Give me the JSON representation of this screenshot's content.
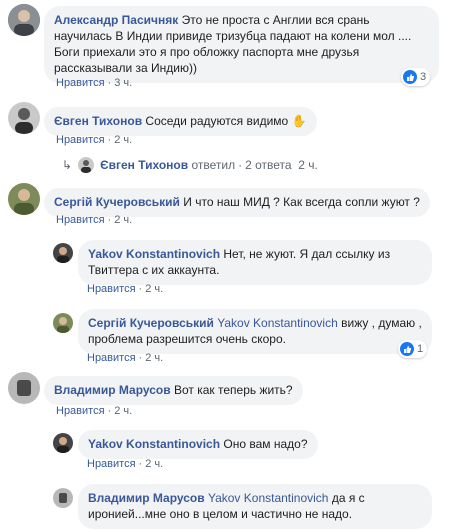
{
  "comments": [
    {
      "author": "Александр Пасичняк",
      "text": "Это не проста с Англии вся срань научилась В Индии привиде тризубца падают на колени мол .... Боги приехали это я про обложку паспорта мне друзья рассказывали за Индию))",
      "like": "Нравится",
      "time": "3 ч.",
      "reactions": "3"
    },
    {
      "author": "Євген Тихонов",
      "text": "Соседи радуются видимо",
      "like": "Нравится",
      "time": "2 ч."
    },
    {
      "author": "Сергій Кучеровський",
      "text": "И что наш МИД ? Как всегда сопли жуют ?",
      "like": "Нравится",
      "time": "2 ч."
    },
    {
      "author": "Yakov Konstantinovich",
      "text": "Нет, не жуют. Я дал ссылку из Твиттера с их аккаунта.",
      "like": "Нравится",
      "time": "2 ч."
    },
    {
      "author": "Сергій Кучеровський",
      "mention": "Yakov Konstantinovich",
      "text": "вижу , думаю , проблема разрешится очень скоро.",
      "like": "Нравится",
      "time": "2 ч.",
      "reactions": "1"
    },
    {
      "author": "Владимир Марусов",
      "text": "Вот как теперь жить?",
      "like": "Нравится",
      "time": "2 ч."
    },
    {
      "author": "Yakov Konstantinovich",
      "text": "Оно вам надо?",
      "like": "Нравится",
      "time": "2 ч."
    },
    {
      "author": "Владимир Марусов",
      "mention": "Yakov Konstantinovich",
      "text": "да я с иронией...мне оно в целом и частично не надо.",
      "like": "Нравится",
      "time": "2 ч."
    }
  ],
  "reply_summary": {
    "author": "Євген Тихонов",
    "action": "ответил",
    "count": "2 ответа",
    "time": "2 ч."
  },
  "colors": {
    "link": "#385898",
    "bubble": "#f2f3f5",
    "meta": "#606770",
    "like_blue": "#1877f2"
  }
}
